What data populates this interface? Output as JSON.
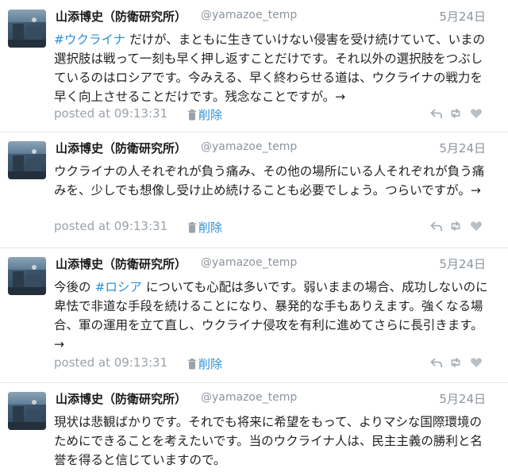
{
  "colors": {
    "hashtag": "#2b8fd6",
    "delete_link": "#2b8fd6",
    "meta_gray": "#8c959e",
    "divider": "#e3e6e9"
  },
  "icons": {
    "reply": "reply-arrow-icon",
    "retweet": "retweet-icon",
    "like": "heart-icon",
    "delete": "trash-icon"
  },
  "tweets": [
    {
      "author_name": "山添博史（防衛研究所）",
      "handle": "@yamazoe_temp",
      "date": "5月24日",
      "hashtag": "#ウクライナ",
      "text_after_hashtag": " だけが、まともに生きていけない侵害を受け続けていて、いまの選択肢は戦って一刻も早く押し返すことだけです。それ以外の選択肢をつぶしているのはロシアです。今みえる、早く終わらせる道は、ウクライナの戦力を早く向上させることだけです。残念なことですが。→",
      "posted": "posted at 09:13:31",
      "delete_label": "削除"
    },
    {
      "author_name": "山添博史（防衛研究所）",
      "handle": "@yamazoe_temp",
      "date": "5月24日",
      "text": "ウクライナの人それぞれが負う痛み、その他の場所にいる人それぞれが負う痛みを、少しでも想像し受け止め続けることも必要でしょう。つらいですが。→",
      "posted": "posted at 09:13:31",
      "delete_label": "削除"
    },
    {
      "author_name": "山添博史（防衛研究所）",
      "handle": "@yamazoe_temp",
      "date": "5月24日",
      "text_before_hashtag": "今後の ",
      "hashtag": "#ロシア",
      "text_after_hashtag": " についても心配は多いです。弱いままの場合、成功しないのに卑怯で非道な手段を続けることになり、暴発的な手もありえます。強くなる場合、軍の運用を立て直し、ウクライナ侵攻を有利に進めてさらに長引きます。→",
      "posted": "posted at 09:13:31",
      "delete_label": "削除"
    },
    {
      "author_name": "山添博史（防衛研究所）",
      "handle": "@yamazoe_temp",
      "date": "5月24日",
      "text": "現状は悲観ばかりです。それでも将来に希望をもって、よりマシな国際環境のためにできることを考えたいです。当のウクライナ人は、民主主義の勝利と名誉を得ると信じていますので。"
    }
  ]
}
